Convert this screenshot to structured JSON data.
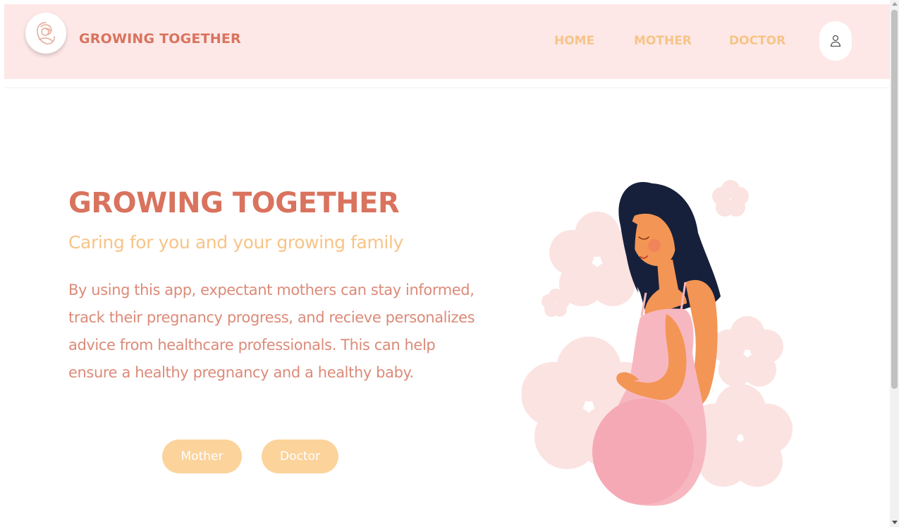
{
  "header": {
    "brand": "GROWING TOGETHER",
    "nav": {
      "home": "HOME",
      "mother": "MOTHER",
      "doctor": "DOCTOR"
    },
    "user_icon": "user-icon",
    "logo_icon": "mother-baby-logo-icon"
  },
  "hero": {
    "title": "GROWING TOGETHER",
    "subtitle": "Caring for you and your growing family",
    "description": "By using this app, expectant mothers can stay informed, track their pregnancy progress, and recieve personalizes advice from healthcare professionals. This can help ensure a healthy pregnancy and a healthy baby.",
    "buttons": {
      "mother": "Mother",
      "doctor": "Doctor"
    },
    "illustration": "pregnant-woman-illustration"
  },
  "colors": {
    "navbar_bg": "#fde8e7",
    "primary": "#d9735e",
    "accent": "#f7c487",
    "button_bg": "#fbd39b",
    "body_text": "#dc8a78"
  }
}
